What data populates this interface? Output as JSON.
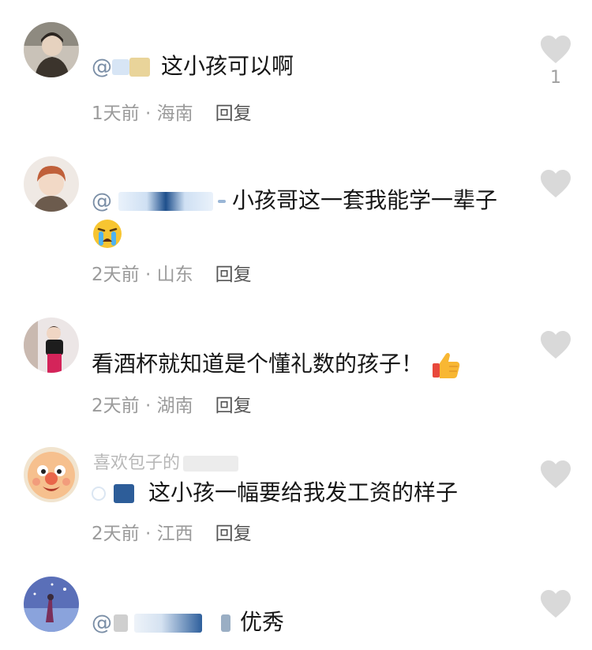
{
  "comments": [
    {
      "username": "",
      "text": "这小孩可以啊",
      "mention": "@",
      "time_location": "1天前 · 海南",
      "reply_label": "回复",
      "likes": "1"
    },
    {
      "username": "",
      "mention": "@",
      "text": "小孩哥这一套我能学一辈子",
      "emoji": "crying-face-emoji",
      "time_location": "2天前 · 山东",
      "reply_label": "回复"
    },
    {
      "username": "",
      "text": "看酒杯就知道是个懂礼数的孩子！",
      "emoji": "thumbs-up-emoji",
      "time_location": "2天前 · 湖南",
      "reply_label": "回复"
    },
    {
      "username": "喜欢包子的",
      "mention": "",
      "text": "这小孩一幅要给我发工资的样子",
      "time_location": "2天前 · 江西",
      "reply_label": "回复"
    },
    {
      "username": "",
      "mention": "@",
      "text": "优秀"
    }
  ],
  "colors": {
    "mention": "#7a8ea6",
    "meta": "#9b9b9b",
    "heart": "#d9d9d9"
  }
}
